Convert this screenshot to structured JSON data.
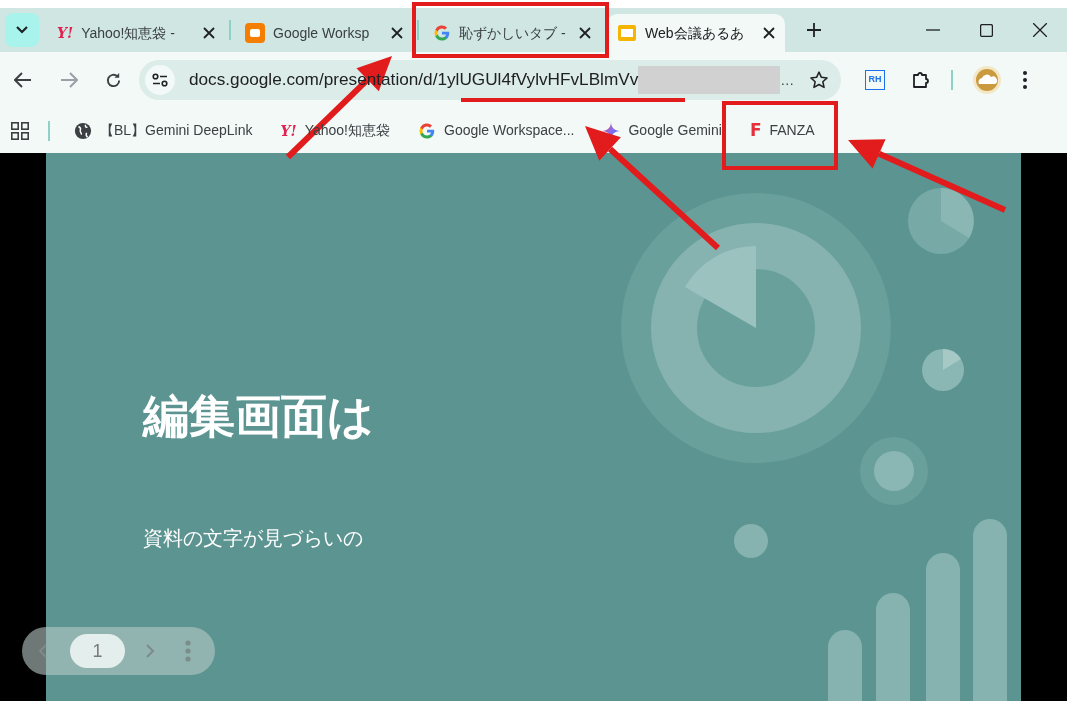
{
  "tabs": [
    {
      "title": "Yahoo!知恵袋 -",
      "kind": "yahoo",
      "logo": "Y!",
      "selected": false
    },
    {
      "title": "Google Worksp",
      "kind": "blogger",
      "selected": false
    },
    {
      "title": "恥ずかしいタブ -",
      "kind": "google",
      "selected": false
    },
    {
      "title": "Web会議あるあ",
      "kind": "slides",
      "selected": true
    }
  ],
  "address_bar": {
    "url": "docs.google.com/presentation/d/1ylUGUl4fVylvHFvLBlmVv",
    "redacted": true,
    "ellipsis": "…"
  },
  "extensions": [
    {
      "kind": "rh",
      "logo": "RH"
    },
    {
      "kind": "puzzle"
    }
  ],
  "bookmarks": [
    {
      "title": "【BL】Gemini DeepLink",
      "kind": "globe"
    },
    {
      "title": "Yahoo!知恵袋",
      "kind": "yahoo",
      "logo": "Y!"
    },
    {
      "title": "Google Workspace...",
      "kind": "google"
    },
    {
      "title": "Google Gemini",
      "kind": "gemini"
    },
    {
      "title": "FANZA",
      "kind": "fanza",
      "logo": "F"
    }
  ],
  "slide": {
    "title": "編集画面は",
    "subtitle": "資料の文字が見づらいの"
  },
  "slide_nav": {
    "page": "1"
  }
}
